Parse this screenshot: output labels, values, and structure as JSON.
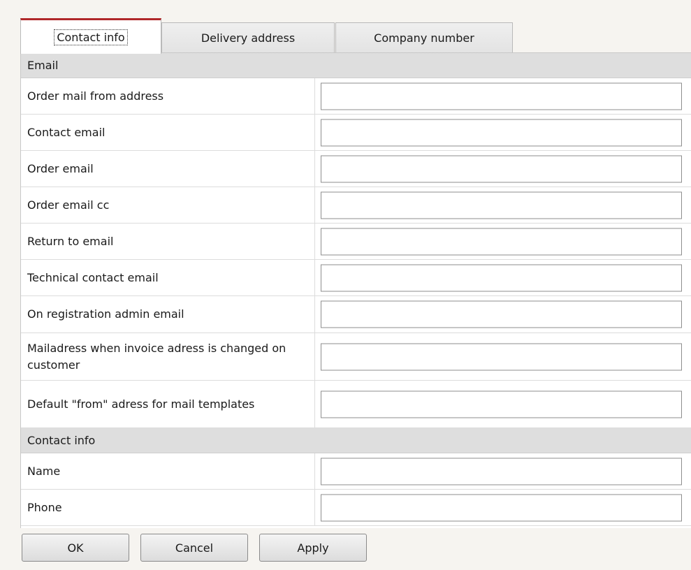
{
  "tabs": [
    {
      "label": "Contact info",
      "active": true
    },
    {
      "label": "Delivery address",
      "active": false
    },
    {
      "label": "Company number",
      "active": false
    }
  ],
  "sections": {
    "email": "Email",
    "contact": "Contact info"
  },
  "fields": {
    "order_mail_from": {
      "label": "Order mail from address",
      "value": ""
    },
    "contact_email": {
      "label": "Contact email",
      "value": ""
    },
    "order_email": {
      "label": "Order email",
      "value": ""
    },
    "order_email_cc": {
      "label": "Order email cc",
      "value": ""
    },
    "return_to_email": {
      "label": "Return to email",
      "value": ""
    },
    "technical_contact_email": {
      "label": "Technical contact email",
      "value": ""
    },
    "registration_admin_email": {
      "label": "On registration admin email",
      "value": ""
    },
    "invoice_change_mail": {
      "label": "Mailadress when invoice adress is changed on customer",
      "value": ""
    },
    "default_from_address": {
      "label": "Default \"from\" adress for mail templates",
      "value": ""
    },
    "name": {
      "label": "Name",
      "value": ""
    },
    "phone": {
      "label": "Phone",
      "value": ""
    }
  },
  "buttons": {
    "ok": "OK",
    "cancel": "Cancel",
    "apply": "Apply"
  },
  "colors": {
    "active_tab_accent": "#b0282a",
    "section_header_bg": "#dedede",
    "window_bg": "#f6f4f0"
  }
}
